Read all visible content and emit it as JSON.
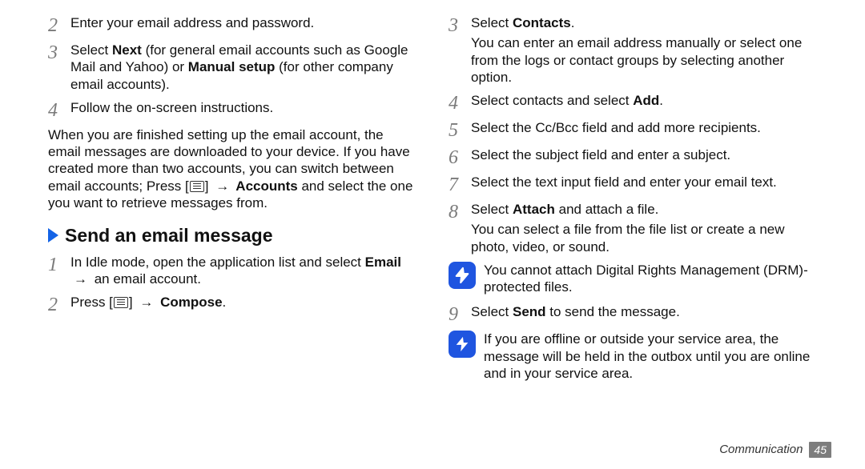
{
  "left": {
    "step2": "Enter your email address and password.",
    "step3": {
      "pre": "Select ",
      "b1": "Next",
      "mid": " (for general email accounts such as Google Mail and Yahoo) or ",
      "b2": "Manual setup",
      "post": " (for other company email accounts)."
    },
    "step4": "Follow the on-screen instructions.",
    "para": {
      "l1": "When you are finished setting up the email account, the email messages are downloaded to your device. If you have created more than two accounts, you can switch between email accounts; Press [",
      "l2": "] ",
      "arrow": "→",
      "b": " Accounts",
      "l3": " and select the one you want to retrieve messages from."
    },
    "section_title": "Send an email message",
    "send_step1": {
      "pre": "In Idle mode, open the application list and select ",
      "b": "Email",
      "mid": " ",
      "arrow": "→",
      "post": " an email account."
    },
    "send_step2": {
      "pre": "Press [",
      "post": "] ",
      "arrow": "→",
      "b": " Compose",
      "dot": "."
    }
  },
  "right": {
    "step3": {
      "pre": "Select ",
      "b": "Contacts",
      "dot": ".",
      "p2": "You can enter an email address manually or select one from the logs or contact groups by selecting another option."
    },
    "step4": {
      "pre": "Select contacts and select ",
      "b": "Add",
      "dot": "."
    },
    "step5": "Select the Cc/Bcc field and add more recipients.",
    "step6": "Select the subject field and enter a subject.",
    "step7": "Select the text input field and enter your email text.",
    "step8": {
      "pre": "Select ",
      "b": "Attach",
      "post": " and attach a file.",
      "p2": "You can select a file from the file list or create a new photo, video, or sound."
    },
    "note1": "You cannot attach Digital Rights Management (DRM)-protected files.",
    "step9": {
      "pre": "Select ",
      "b": "Send",
      "post": " to send the message."
    },
    "note2": "If you are offline or outside your service area, the message will be held in the outbox until you are online and in your service area."
  },
  "nums": {
    "n1": "1",
    "n2": "2",
    "n3": "3",
    "n4": "4",
    "n5": "5",
    "n6": "6",
    "n7": "7",
    "n8": "8",
    "n9": "9"
  },
  "footer": {
    "label": "Communication",
    "page": "45"
  }
}
